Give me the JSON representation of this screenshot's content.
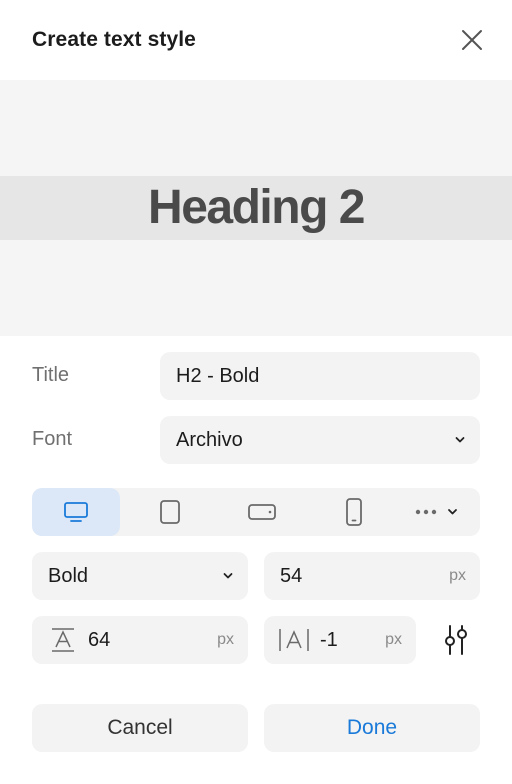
{
  "dialog": {
    "title": "Create text style"
  },
  "preview": {
    "sample_text": "Heading 2"
  },
  "form": {
    "title_label": "Title",
    "title_value": "H2 - Bold",
    "font_label": "Font",
    "font_value": "Archivo"
  },
  "devices": {
    "items": [
      "desktop-icon",
      "tablet-icon",
      "tablet-landscape-icon",
      "phone-icon",
      "more-icon"
    ],
    "selected": "desktop"
  },
  "weight": {
    "value": "Bold"
  },
  "size": {
    "value": "54",
    "unit": "px"
  },
  "line_height": {
    "value": "64",
    "unit": "px"
  },
  "letter_spacing": {
    "value": "-1",
    "unit": "px"
  },
  "buttons": {
    "cancel": "Cancel",
    "done": "Done"
  },
  "colors": {
    "accent": "#1a7ad9",
    "active_device_bg": "#dce8f8",
    "field_bg": "#f3f3f3",
    "preview_bg": "#f5f5f5",
    "preview_band": "#e6e6e6"
  }
}
